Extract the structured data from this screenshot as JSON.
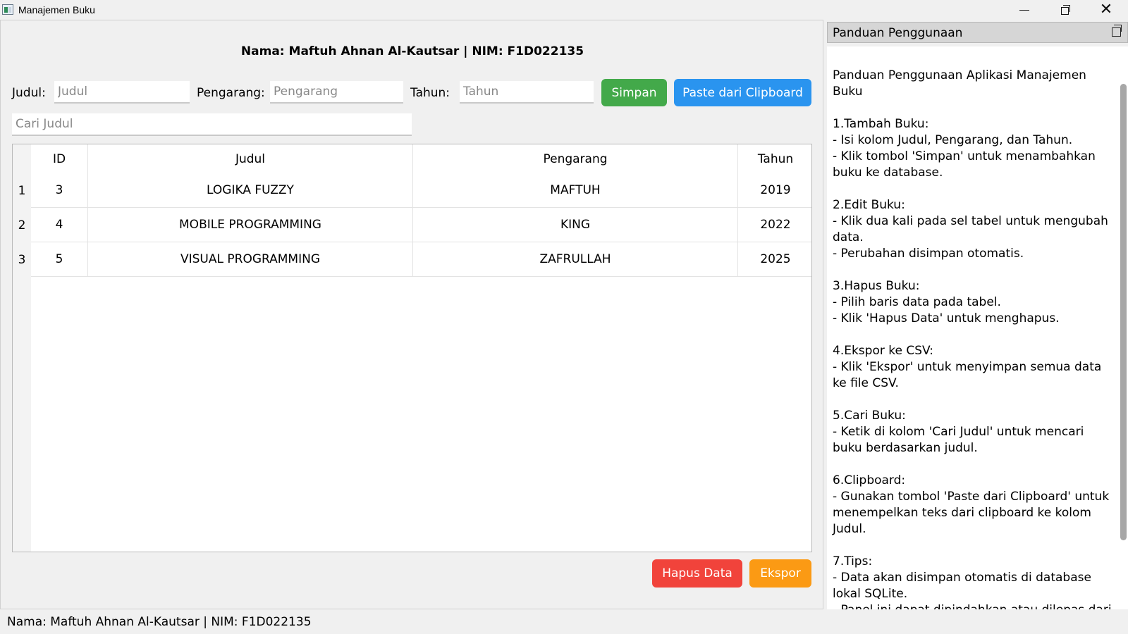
{
  "window": {
    "title": "Manajemen Buku",
    "minimize_label": "─",
    "close_label": "✕"
  },
  "header": {
    "identity": "Nama: Maftuh Ahnan Al-Kautsar  |  NIM: F1D022135"
  },
  "form": {
    "judul_label": "Judul:",
    "judul_placeholder": "Judul",
    "pengarang_label": "Pengarang:",
    "pengarang_placeholder": "Pengarang",
    "tahun_label": "Tahun:",
    "tahun_placeholder": "Tahun",
    "save_label": "Simpan",
    "paste_label": "Paste dari Clipboard",
    "search_placeholder": "Cari Judul"
  },
  "table": {
    "columns": [
      "ID",
      "Judul",
      "Pengarang",
      "Tahun"
    ],
    "rows": [
      {
        "num": "1",
        "id": "3",
        "judul": "LOGIKA FUZZY",
        "pengarang": "MAFTUH",
        "tahun": "2019"
      },
      {
        "num": "2",
        "id": "4",
        "judul": "MOBILE PROGRAMMING",
        "pengarang": "KING",
        "tahun": "2022"
      },
      {
        "num": "3",
        "id": "5",
        "judul": "VISUAL PROGRAMMING",
        "pengarang": "ZAFRULLAH",
        "tahun": "2025"
      }
    ]
  },
  "actions": {
    "delete_label": "Hapus Data",
    "export_label": "Ekspor"
  },
  "statusbar": {
    "text": "Nama: Maftuh Ahnan Al-Kautsar | NIM: F1D022135"
  },
  "dock": {
    "title": "Panduan Penggunaan",
    "content": "Panduan Penggunaan Aplikasi Manajemen Buku\n\n1.Tambah Buku:\n- Isi kolom Judul, Pengarang, dan Tahun.\n- Klik tombol 'Simpan' untuk menambahkan buku ke database.\n\n2.Edit Buku:\n- Klik dua kali pada sel tabel untuk mengubah data.\n- Perubahan disimpan otomatis.\n\n3.Hapus Buku:\n- Pilih baris data pada tabel.\n- Klik 'Hapus Data' untuk menghapus.\n\n4.Ekspor ke CSV:\n- Klik 'Ekspor' untuk menyimpan semua data ke file CSV.\n\n5.Cari Buku:\n- Ketik di kolom 'Cari Judul' untuk mencari buku berdasarkan judul.\n\n6.Clipboard:\n- Gunakan tombol 'Paste dari Clipboard' untuk menempelkan teks dari clipboard ke kolom Judul.\n\n7.Tips:\n- Data akan disimpan otomatis di database lokal SQLite.\n- Panel ini dapat dipindahkan atau dilepas dari"
  },
  "colors": {
    "save": "#43a94a",
    "paste": "#2a94ef",
    "delete": "#f1433b",
    "export": "#fb9a14"
  }
}
